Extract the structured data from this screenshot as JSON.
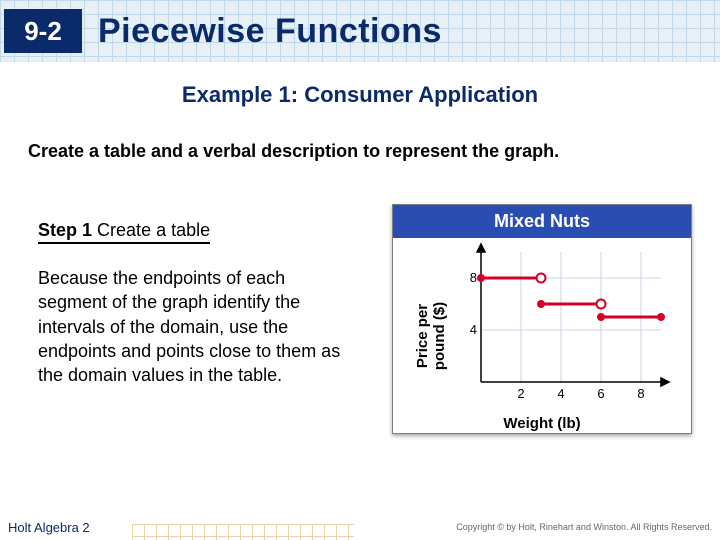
{
  "lesson_number": "9-2",
  "title": "Piecewise Functions",
  "subtitle": "Example 1: Consumer Application",
  "instruction": "Create a table and a verbal description to represent the graph.",
  "step_label": "Step 1",
  "step_text": "Create a table",
  "body": "Because the endpoints of each segment of the graph identify the intervals of the domain, use the endpoints and points close to them as the domain values in the table.",
  "graph": {
    "title": "Mixed Nuts",
    "x_label": "Weight (lb)",
    "y_label": "Price per\npound ($)",
    "x_ticks": [
      2,
      4,
      6,
      8
    ],
    "y_ticks": [
      4,
      8
    ]
  },
  "chart_data": {
    "type": "line",
    "title": "Mixed Nuts",
    "xlabel": "Weight (lb)",
    "ylabel": "Price per pound ($)",
    "xlim": [
      0,
      9
    ],
    "ylim": [
      0,
      10
    ],
    "series": [
      {
        "name": "segment1",
        "x": [
          0,
          3
        ],
        "values": [
          8,
          8
        ],
        "left_closed": true,
        "right_closed": false
      },
      {
        "name": "segment2",
        "x": [
          3,
          6
        ],
        "values": [
          6,
          6
        ],
        "left_closed": true,
        "right_closed": false
      },
      {
        "name": "segment3",
        "x": [
          6,
          9
        ],
        "values": [
          5,
          5
        ],
        "left_closed": true,
        "right_closed": true
      }
    ]
  },
  "footer": {
    "left": "Holt Algebra 2",
    "right": "Copyright © by Holt, Rinehart and Winston. All Rights Reserved."
  }
}
